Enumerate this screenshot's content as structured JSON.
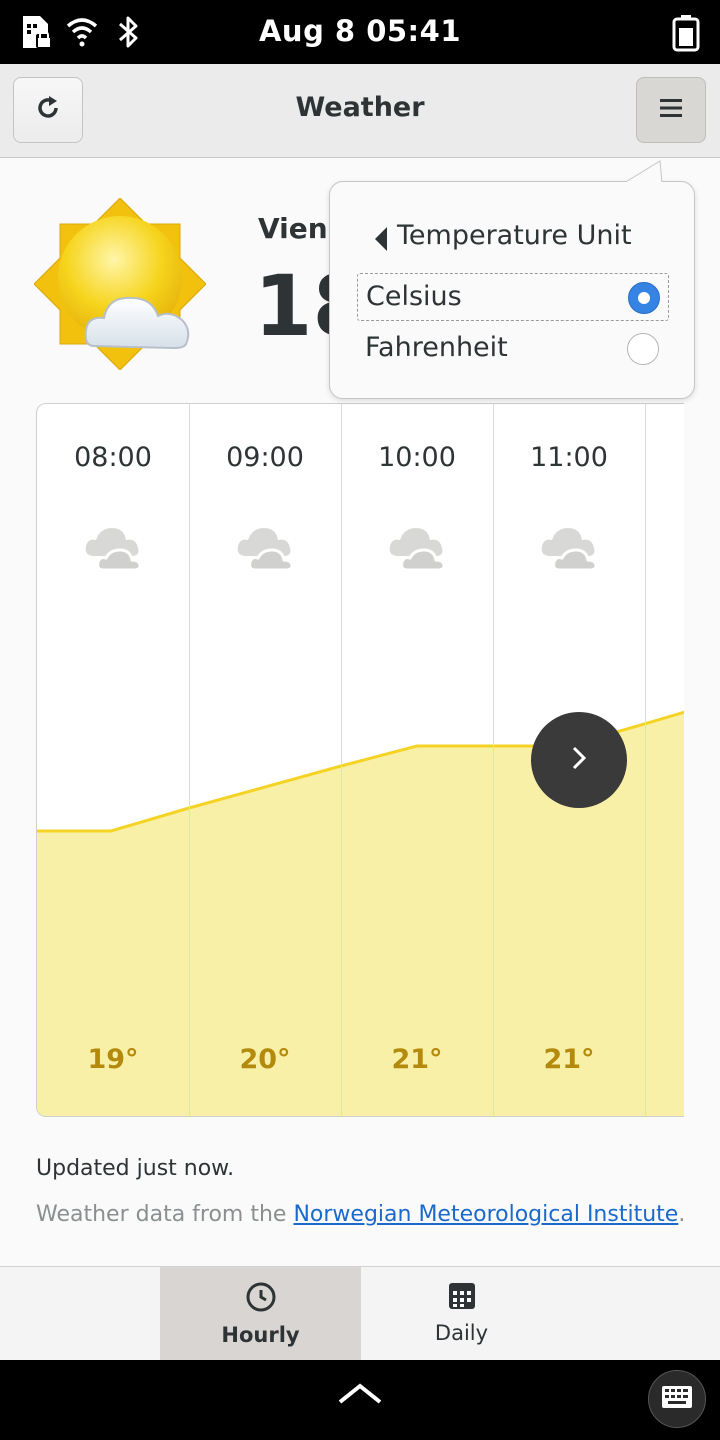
{
  "status_bar": {
    "time": "Aug 8  05:41",
    "icons": [
      "sim-icon",
      "wifi-icon",
      "bluetooth-icon",
      "battery-icon"
    ]
  },
  "header": {
    "title": "Weather",
    "refresh_icon": "refresh-icon",
    "menu_icon": "hamburger-menu-icon"
  },
  "current": {
    "location": "Vienna",
    "temperature": "18°",
    "condition_icon": "partly-cloudy-sun-icon"
  },
  "hourly": {
    "hours": [
      {
        "time": "08:00",
        "temp": "19°",
        "icon": "cloudy-icon"
      },
      {
        "time": "09:00",
        "temp": "20°",
        "icon": "cloudy-icon"
      },
      {
        "time": "10:00",
        "temp": "21°",
        "icon": "cloudy-icon"
      },
      {
        "time": "11:00",
        "temp": "21°",
        "icon": "cloudy-icon"
      }
    ],
    "graph_fill_color": "#f9f0a8",
    "graph_line_color": "#f5d325",
    "next_icon": "chevron-right-icon"
  },
  "footer": {
    "updated": "Updated just now.",
    "attribution_prefix": "Weather data from the ",
    "attribution_link": "Norwegian Meteorological Institute",
    "attribution_suffix": "."
  },
  "view_switcher": {
    "hourly_label": "Hourly",
    "daily_label": "Daily",
    "active": "Hourly"
  },
  "popover": {
    "title": "Temperature Unit",
    "options": [
      {
        "label": "Celsius",
        "selected": true
      },
      {
        "label": "Fahrenheit",
        "selected": false
      }
    ]
  },
  "colors": {
    "accent": "#3584e4",
    "temp_text": "#b48a0c",
    "link": "#1b6acb"
  }
}
